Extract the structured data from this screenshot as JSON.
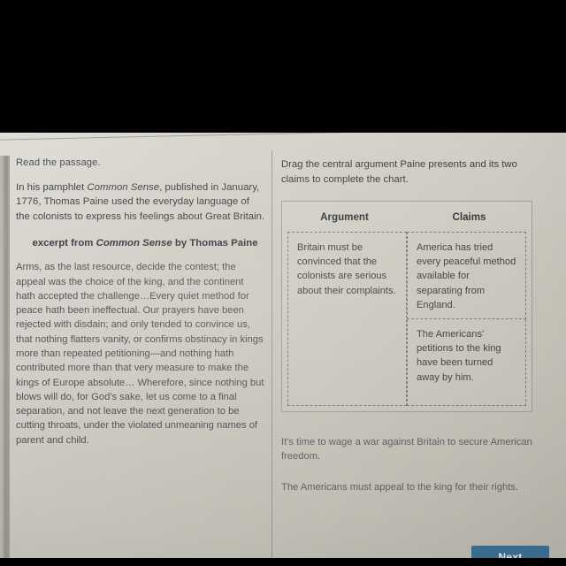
{
  "passage_pane": {
    "read_instruction": "Read the passage.",
    "intro_before_title": "In his pamphlet ",
    "intro_title": "Common Sense",
    "intro_after_title": ", published in January, 1776, Thomas Paine used the everyday language of the colonists to express his feelings about Great Britain.",
    "excerpt_heading_before": "excerpt from ",
    "excerpt_heading_title": "Common Sense",
    "excerpt_heading_after": " by Thomas Paine",
    "excerpt_text": "Arms, as the last resource, decide the contest; the appeal was the choice of the king, and the continent hath accepted the challenge…Every quiet method for peace hath been ineffectual. Our prayers have been rejected with disdain; and only tended to convince us, that nothing flatters vanity, or confirms obstinacy in kings more than repeated petitioning—and nothing hath contributed more than that very measure to make the kings of Europe absolute… Wherefore, since nothing but blows will do, for God's sake, let us come to a final separation, and not leave the next generation to be cutting throats, under the violated unmeaning names of parent and child."
  },
  "question_pane": {
    "instruction": "Drag the central argument Paine presents and its two claims to complete the chart.",
    "chart": {
      "columns": [
        {
          "header": "Argument"
        },
        {
          "header": "Claims"
        }
      ],
      "argument_cell": "Britain must be convinced that the colonists are serious about their complaints.",
      "claim_cells": [
        "America has tried every peaceful method available for separating from England.",
        "The Americans' petitions to the king have been turned away by him."
      ]
    },
    "options": [
      "It's time to wage a war against Britain to secure American freedom.",
      "The Americans must appeal to the king for their rights."
    ]
  },
  "footer": {
    "next_label": "Next"
  },
  "colors": {
    "page_background": "#cac7bd",
    "body_text": "#3f4145",
    "muted_text": "#5c5e62",
    "chart_border": "#787a7e",
    "next_button": "#3c6f92",
    "letterbox": "#000000"
  }
}
